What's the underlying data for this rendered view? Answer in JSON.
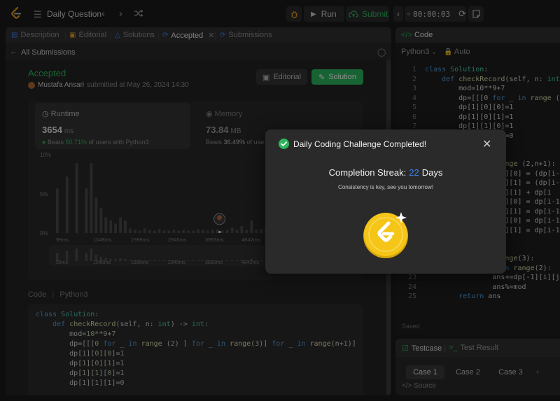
{
  "topbar": {
    "title": "Daily Question",
    "run_label": "Run",
    "submit_label": "Submit",
    "timer": "00:00:03"
  },
  "left_tabs": [
    {
      "label": "Description"
    },
    {
      "label": "Editorial"
    },
    {
      "label": "Solutions"
    },
    {
      "label": "Accepted"
    },
    {
      "label": "Submissions"
    }
  ],
  "back_label": "All Submissions",
  "submission": {
    "status": "Accepted",
    "author": "Mustafa Ansari",
    "submitted": "submitted at May 26, 2024 14:30",
    "editorial_label": "Editorial",
    "solution_label": "Solution"
  },
  "runtime": {
    "heading": "Runtime",
    "value": "3654",
    "unit": "ms",
    "beats_prefix": "Beats",
    "beats_pct": "50.71%",
    "beats_suffix": "of users with Python3"
  },
  "memory": {
    "heading": "Memory",
    "value": "73.84",
    "unit": "MB",
    "beats_prefix": "Beats",
    "beats_pct": "36.49%",
    "beats_suffix": "of use"
  },
  "chart_data": {
    "type": "bar",
    "ylabels": [
      "10%",
      "5%",
      "0%"
    ],
    "ylim": [
      0,
      10
    ],
    "xticks": [
      "99ms",
      "1048ms",
      "1996ms",
      "2945ms",
      "3893ms",
      "4842ms"
    ],
    "minimap_ticks": [
      "99ms",
      "1048ms",
      "1996ms",
      "2945ms",
      "3893ms",
      "4842ms"
    ],
    "values": [
      5.7,
      0,
      7.2,
      0,
      8.9,
      0,
      5.7,
      8.9,
      4.5,
      3.2,
      2.0,
      1.6,
      1.2,
      2.0,
      1.6,
      0.6,
      0.4,
      0.3,
      0.6,
      0.4,
      0.3,
      0.5,
      0.3,
      0.3,
      0.4,
      0.3,
      0.4,
      0.3,
      0.3,
      0.5,
      0.4,
      0.3,
      0.4,
      0.5,
      0.3,
      0.4,
      0.7,
      0.4,
      0.9,
      0.4,
      1.6,
      0.4,
      0.5,
      0.8,
      1.6,
      0.6,
      1.2,
      2.0,
      1.6,
      0.6,
      2.4,
      0.8,
      2.0,
      0.6,
      2.4,
      0.8,
      1.8,
      0.5,
      0.4,
      1.8,
      0.3,
      0.5
    ]
  },
  "code_section": {
    "label": "Code",
    "lang": "Python3",
    "lines": [
      "class Solution:",
      "    def checkRecord(self, n: int) -> int:",
      "        mod=10**9+7",
      "        dp=[[[0 for _ in range (2) ] for _ in range(3)] for _ in range(n+1)]",
      "        dp[1][0][0]=1",
      "        dp[1][0][1]=1",
      "        dp[1][1][0]=1",
      "        dp[1][1][1]=0"
    ]
  },
  "editor": {
    "title": "Code",
    "lang": "Python3",
    "mode": "Auto",
    "saved": "Saved",
    "lines": [
      {
        "n": "1",
        "t": "class Solution:"
      },
      {
        "n": "2",
        "t": "    def checkRecord(self, n: int)"
      },
      {
        "n": "3",
        "t": "        mod=10**9+7"
      },
      {
        "n": "4",
        "t": "        dp=[[[0 for _ in range (2)"
      },
      {
        "n": "5",
        "t": "        dp[1][0][0]=1"
      },
      {
        "n": "6",
        "t": "        dp[1][0][1]=1"
      },
      {
        "n": "7",
        "t": "        dp[1][1][0]=1"
      },
      {
        "n": "8",
        "t": "        dp[1][1][1]=0"
      },
      {
        "n": "9",
        "t": ""
      },
      {
        "n": "10",
        "t": ""
      },
      {
        "n": "11",
        "t": "        for i in range (2,n+1):"
      },
      {
        "n": "12",
        "t": "            dp[i][0][0] = (dp[i-1]"
      },
      {
        "n": "13",
        "t": "            dp[i][0][1] = (dp[i-1]"
      },
      {
        "n": "14",
        "t": "            dp[i][1][1] + dp[i"
      },
      {
        "n": "15",
        "t": "            dp[i][1][0] = dp[i-1]["
      },
      {
        "n": "16",
        "t": "            dp[i][1][1] = dp[i-1]["
      },
      {
        "n": "17",
        "t": "            dp[i][2][0] = dp[i-1]["
      },
      {
        "n": "18",
        "t": "            dp[i][2][1] = dp[i-1]["
      },
      {
        "n": "19",
        "t": ""
      },
      {
        "n": "20",
        "t": "        ans=0"
      },
      {
        "n": "21",
        "t": "        for i in range(3):"
      },
      {
        "n": "22",
        "t": "            for j in range(2):"
      },
      {
        "n": "23",
        "t": "                ans+=dp[-1][i][j]"
      },
      {
        "n": "24",
        "t": "                ans%=mod"
      },
      {
        "n": "25",
        "t": "        return ans"
      }
    ]
  },
  "testcase": {
    "tab1": "Testcase",
    "tab2": "Test Result",
    "cases": [
      "Case 1",
      "Case 2",
      "Case 3"
    ],
    "source": "Source"
  },
  "modal": {
    "title": "Daily Coding Challenge Completed!",
    "streak_prefix": "Completion Streak:",
    "streak_count": "22",
    "streak_suffix": "Days",
    "message": "Consistency is key, see you tomorrow!"
  },
  "colors": {
    "accent_green": "#2db55d",
    "streak_blue": "#3b82f6",
    "coin_gold": "#f5c518"
  }
}
